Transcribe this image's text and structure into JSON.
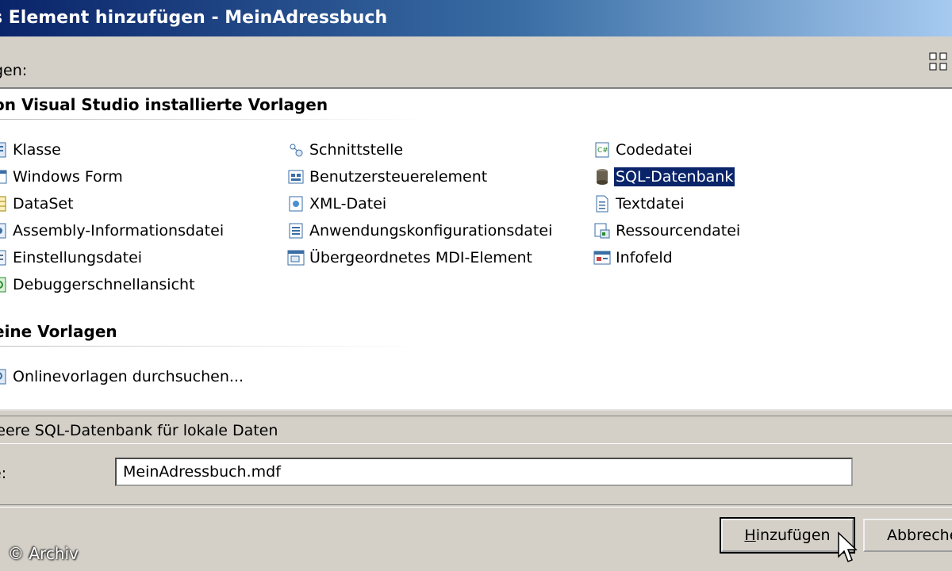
{
  "window": {
    "title": "s Element hinzufügen - MeinAdressbuch"
  },
  "templates_label": "gen:",
  "groups": [
    {
      "header": "on Visual Studio installierte Vorlagen",
      "items": [
        {
          "label": "Klasse",
          "icon": "class-icon"
        },
        {
          "label": "Windows Form",
          "icon": "windows-form-icon"
        },
        {
          "label": "DataSet",
          "icon": "dataset-icon"
        },
        {
          "label": "Assembly-Informationsdatei",
          "icon": "assembly-info-icon"
        },
        {
          "label": "Einstellungsdatei",
          "icon": "settings-file-icon"
        },
        {
          "label": "Debuggerschnellansicht",
          "icon": "debugger-visualizer-icon"
        },
        {
          "label": "Schnittstelle",
          "icon": "interface-icon"
        },
        {
          "label": "Benutzersteuerelement",
          "icon": "user-control-icon"
        },
        {
          "label": "XML-Datei",
          "icon": "xml-file-icon"
        },
        {
          "label": "Anwendungskonfigurationsdatei",
          "icon": "app-config-icon"
        },
        {
          "label": "Übergeordnetes MDI-Element",
          "icon": "mdi-parent-icon"
        },
        {
          "label": "Codedatei",
          "icon": "code-file-icon"
        },
        {
          "label": "SQL-Datenbank",
          "icon": "database-icon",
          "selected": true
        },
        {
          "label": "Textdatei",
          "icon": "text-file-icon"
        },
        {
          "label": "Ressourcendatei",
          "icon": "resource-file-icon"
        },
        {
          "label": "Infofeld",
          "icon": "about-box-icon"
        }
      ]
    },
    {
      "header": "eine Vorlagen",
      "items": [
        {
          "label": "Onlinevorlagen durchsuchen...",
          "icon": "search-online-icon"
        }
      ]
    }
  ],
  "description": "leere SQL-Datenbank für lokale Daten",
  "name_field": {
    "label": "e:",
    "value": "MeinAdressbuch.mdf"
  },
  "buttons": {
    "add": {
      "accel": "H",
      "rest": "inzufügen"
    },
    "cancel": "Abbrechen"
  },
  "watermark": "© Archiv"
}
